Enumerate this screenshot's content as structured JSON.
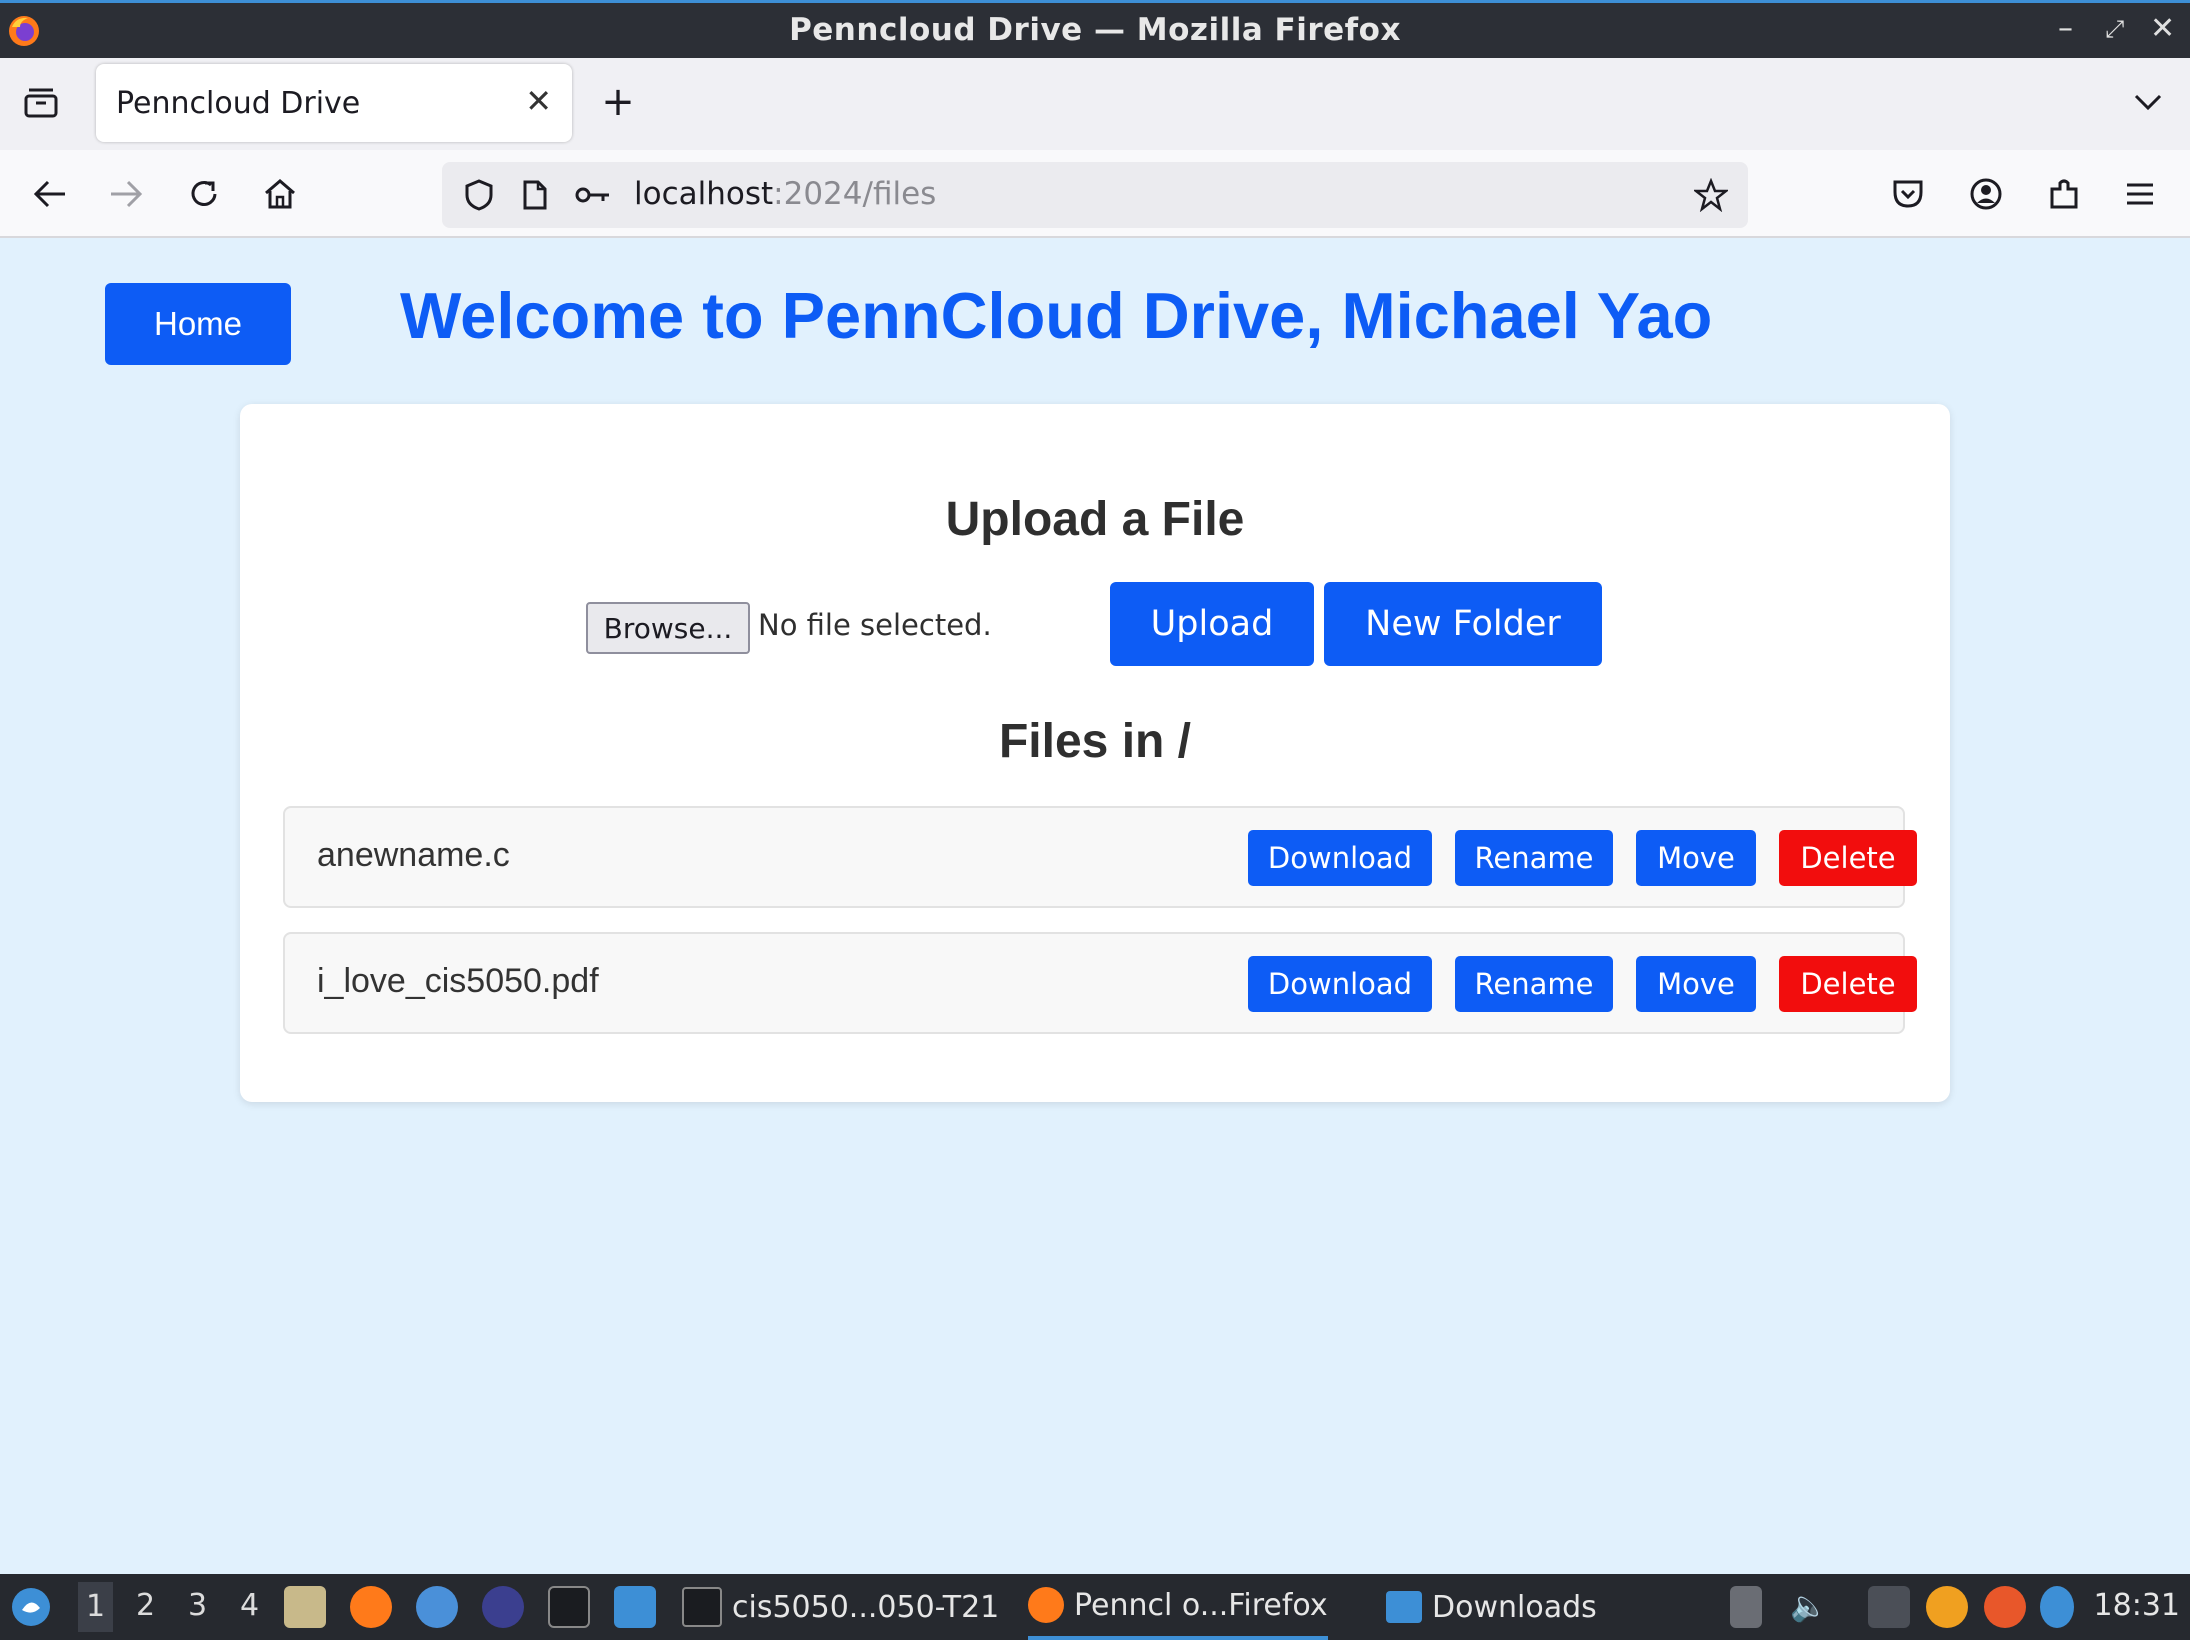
{
  "window": {
    "title": "Penncloud Drive — Mozilla Firefox"
  },
  "browser": {
    "tab_title": "Penncloud Drive",
    "url_host": "localhost",
    "url_path": ":2024/files"
  },
  "page": {
    "home_label": "Home",
    "welcome": "Welcome to PennCloud Drive, Michael Yao",
    "upload_heading": "Upload a File",
    "browse_label": "Browse...",
    "no_file_text": "No file selected.",
    "upload_label": "Upload",
    "new_folder_label": "New Folder",
    "files_heading": "Files in /",
    "files": [
      {
        "name": "anewname.c",
        "download": "Download",
        "rename": "Rename",
        "move": "Move",
        "delete": "Delete"
      },
      {
        "name": "i_love_cis5050.pdf",
        "download": "Download",
        "rename": "Rename",
        "move": "Move",
        "delete": "Delete"
      }
    ]
  },
  "taskbar": {
    "workspaces": [
      "1",
      "2",
      "3",
      "4"
    ],
    "tasks": [
      "cis5050...050-T21",
      "Penncl o...Firefox",
      "Downloads"
    ],
    "clock": "18:31"
  },
  "colors": {
    "primary": "#0d5cf5",
    "danger": "#f20d0d",
    "background": "#e1f1fd"
  }
}
